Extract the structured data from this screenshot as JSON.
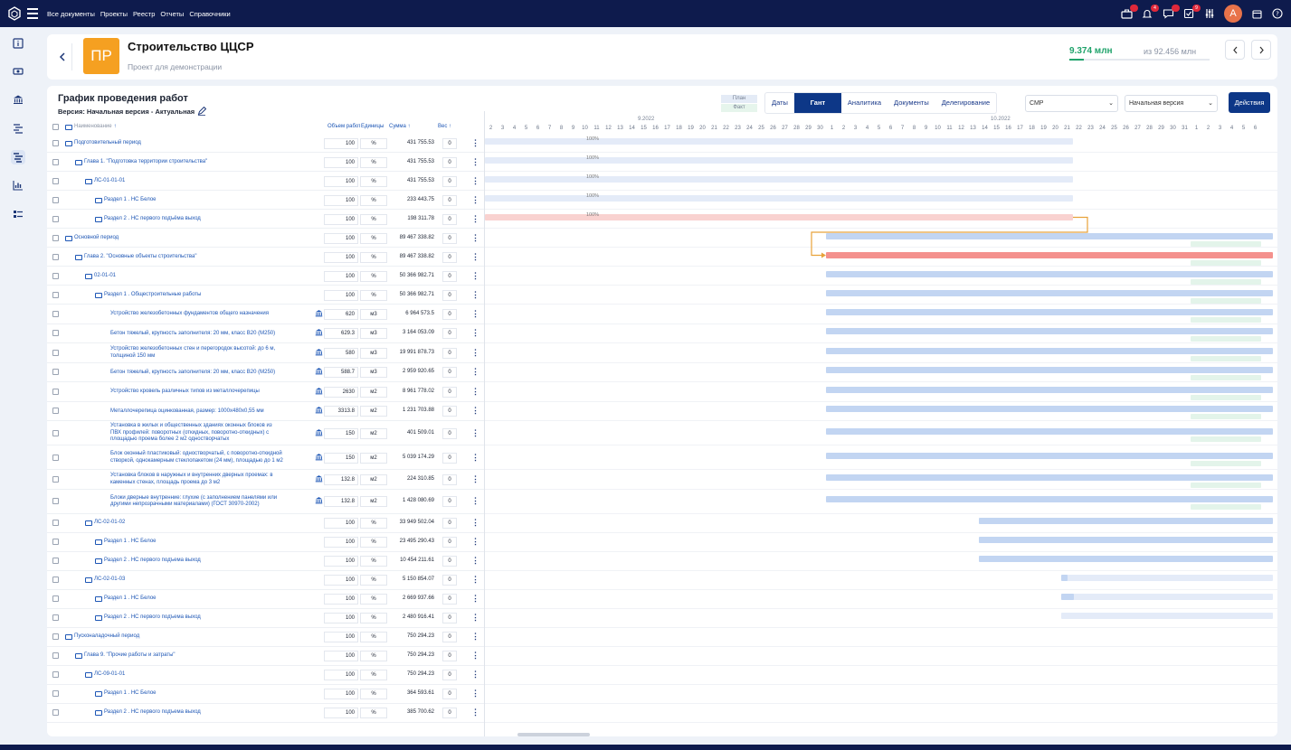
{
  "topbar": {
    "menu": [
      "Все документы",
      "Проекты",
      "Реестр",
      "Отчеты",
      "Справочники"
    ],
    "badges": [
      "",
      "4",
      "",
      "9"
    ],
    "avatar": "A"
  },
  "header": {
    "logo_text": "ПР",
    "title": "Строительство ЦЦСР",
    "subtitle": "Проект для демонстрации",
    "spent": "9.374 млн",
    "total": "из 92.456 млн",
    "progress": 0.101
  },
  "main": {
    "title": "График проведения работ",
    "version": "Версия: Начальная версия - Актуальная",
    "legend": {
      "plan": "План",
      "fact": "Факт"
    },
    "tabs": [
      "Даты",
      "Гант",
      "Аналитика",
      "Документы",
      "Делегирование"
    ],
    "active_tab": "Гант",
    "select1": "СМР",
    "select2": "Начальная версия",
    "actions": "Действия"
  },
  "columns": {
    "name": "Наименование",
    "volume": "Объем работ",
    "unit": "Единицы",
    "sum": "Сумма",
    "weight": "Вес"
  },
  "rows": [
    {
      "level": 0,
      "folder": true,
      "name": "Подготовительный период",
      "volume": "100",
      "unit": "%",
      "sum": "431 755.53",
      "weight": "0"
    },
    {
      "level": 1,
      "folder": true,
      "name": "Глава 1. \"Подготовка территории строительства\"",
      "volume": "100",
      "unit": "%",
      "sum": "431 755.53",
      "weight": "0"
    },
    {
      "level": 2,
      "folder": true,
      "name": "ЛС-01-01-01",
      "volume": "100",
      "unit": "%",
      "sum": "431 755.53",
      "weight": "0"
    },
    {
      "level": 3,
      "folder": true,
      "name": "Раздел 1 . НС Белое",
      "volume": "100",
      "unit": "%",
      "sum": "233 443.75",
      "weight": "0"
    },
    {
      "level": 3,
      "folder": true,
      "name": "Раздел 2 . НС первого подъёма выход",
      "volume": "100",
      "unit": "%",
      "sum": "198 311.78",
      "weight": "0"
    },
    {
      "level": 0,
      "folder": true,
      "name": "Основной период",
      "volume": "100",
      "unit": "%",
      "sum": "89 467 338.82",
      "weight": "0"
    },
    {
      "level": 1,
      "folder": true,
      "name": "Глава 2. \"Основные объекты строительства\"",
      "volume": "100",
      "unit": "%",
      "sum": "89 467 338.82",
      "weight": "0"
    },
    {
      "level": 2,
      "folder": true,
      "name": "02-01-01",
      "volume": "100",
      "unit": "%",
      "sum": "50 366 982.71",
      "weight": "0"
    },
    {
      "level": 3,
      "folder": true,
      "name": "Раздел 1 . Общестроительные работы",
      "volume": "100",
      "unit": "%",
      "sum": "50 366 982.71",
      "weight": "0"
    },
    {
      "level": 4,
      "folder": false,
      "name": "Устройство железобетонных фундаментов общего назначения",
      "volume": "620",
      "unit": "м3",
      "sum": "6 964 573.5",
      "weight": "0"
    },
    {
      "level": 4,
      "folder": false,
      "name": "Бетон тяжелый, крупность заполнителя: 20 мм, класс В20 (М250)",
      "volume": "629.3",
      "unit": "м3",
      "sum": "3 164 053.09",
      "weight": "0"
    },
    {
      "level": 4,
      "folder": false,
      "name": "Устройство железобетонных стен и перегородок высотой: до 6 м, толщиной 150 мм",
      "volume": "580",
      "unit": "м3",
      "sum": "19 991 878.73",
      "weight": "0"
    },
    {
      "level": 4,
      "folder": false,
      "name": "Бетон тяжелый, крупность заполнителя: 20 мм, класс В20 (М250)",
      "volume": "588.7",
      "unit": "м3",
      "sum": "2 959 920.65",
      "weight": "0"
    },
    {
      "level": 4,
      "folder": false,
      "name": "Устройство кровель различных типов из металлочерепицы",
      "volume": "2630",
      "unit": "м2",
      "sum": "8 961 778.02",
      "weight": "0"
    },
    {
      "level": 4,
      "folder": false,
      "name": "Металлочерепица оцинкованная, размер: 1000x480x0,55 мм",
      "volume": "3313.8",
      "unit": "м2",
      "sum": "1 231 703.88",
      "weight": "0"
    },
    {
      "level": 4,
      "folder": false,
      "name": "Установка в жилых и общественных зданиях оконных блоков из ПВХ профилей: поворотных (откидных, поворотно-откидных) с площадью проема более 2 м2 одностворчатых",
      "volume": "150",
      "unit": "м2",
      "sum": "401 509.01",
      "weight": "0"
    },
    {
      "level": 4,
      "folder": false,
      "name": "Блок оконный пластиковый: одностворчатый, с поворотно-откидной створкой, однокамерным стеклопакетом (24 мм), площадью до 1 м2",
      "volume": "150",
      "unit": "м2",
      "sum": "5 039 174.29",
      "weight": "0"
    },
    {
      "level": 4,
      "folder": false,
      "name": "Установка блоков в наружных и внутренних дверных проемах: в каменных стенах, площадь проема до 3 м2",
      "volume": "132.8",
      "unit": "м2",
      "sum": "224 310.85",
      "weight": "0"
    },
    {
      "level": 4,
      "folder": false,
      "name": "Блоки дверные внутренние: глухие (с заполнением панелями или другими непрозрачными материалами) (ГОСТ 30970-2002)",
      "volume": "132.8",
      "unit": "м2",
      "sum": "1 428 080.69",
      "weight": "0"
    },
    {
      "level": 2,
      "folder": true,
      "name": "ЛС-02-01-02",
      "volume": "100",
      "unit": "%",
      "sum": "33 949 502.04",
      "weight": "0"
    },
    {
      "level": 3,
      "folder": true,
      "name": "Раздел 1 . НС Белое",
      "volume": "100",
      "unit": "%",
      "sum": "23 495 290.43",
      "weight": "0"
    },
    {
      "level": 3,
      "folder": true,
      "name": "Раздел 2 . НС первого подъема выход",
      "volume": "100",
      "unit": "%",
      "sum": "10 454 211.61",
      "weight": "0"
    },
    {
      "level": 2,
      "folder": true,
      "name": "ЛС-02-01-03",
      "volume": "100",
      "unit": "%",
      "sum": "5 150 854.07",
      "weight": "0"
    },
    {
      "level": 3,
      "folder": true,
      "name": "Раздел 1 . НС Белое",
      "volume": "100",
      "unit": "%",
      "sum": "2 669 937.66",
      "weight": "0"
    },
    {
      "level": 3,
      "folder": true,
      "name": "Раздел 2 . НС первого подъема выход",
      "volume": "100",
      "unit": "%",
      "sum": "2 480 916.41",
      "weight": "0"
    },
    {
      "level": 0,
      "folder": true,
      "name": "Пусконаладочный период",
      "volume": "100",
      "unit": "%",
      "sum": "750 294.23",
      "weight": "0"
    },
    {
      "level": 1,
      "folder": true,
      "name": "Глава 9. \"Прочие работы и затраты\"",
      "volume": "100",
      "unit": "%",
      "sum": "750 294.23",
      "weight": "0"
    },
    {
      "level": 2,
      "folder": true,
      "name": "ЛС-09-01-01",
      "volume": "100",
      "unit": "%",
      "sum": "750 294.23",
      "weight": "0"
    },
    {
      "level": 3,
      "folder": true,
      "name": "Раздел 1 . НС Белое",
      "volume": "100",
      "unit": "%",
      "sum": "364 593.61",
      "weight": "0"
    },
    {
      "level": 3,
      "folder": true,
      "name": "Раздел 2 . НС первого подъема выход",
      "volume": "100",
      "unit": "%",
      "sum": "385 700.62",
      "weight": "0"
    }
  ],
  "gantt": {
    "months": [
      {
        "label": "9.2022",
        "day_index": 13
      },
      {
        "label": "10.2022",
        "day_index": 43
      }
    ],
    "days": [
      "2",
      "3",
      "4",
      "5",
      "6",
      "7",
      "8",
      "9",
      "10",
      "11",
      "12",
      "13",
      "14",
      "15",
      "16",
      "17",
      "18",
      "19",
      "20",
      "21",
      "22",
      "23",
      "24",
      "25",
      "26",
      "27",
      "28",
      "29",
      "30",
      "1",
      "2",
      "3",
      "4",
      "5",
      "6",
      "7",
      "8",
      "9",
      "10",
      "11",
      "12",
      "13",
      "14",
      "15",
      "16",
      "17",
      "18",
      "19",
      "20",
      "21",
      "22",
      "23",
      "24",
      "25",
      "26",
      "27",
      "28",
      "29",
      "30",
      "31",
      "1",
      "2",
      "3",
      "4",
      "5",
      "6"
    ],
    "plan_color": "#c9d8f2",
    "fact_color": "#e3f4ea",
    "critical_color": "#f4918d",
    "bars": [
      {
        "row": 0,
        "start": 0,
        "end": 50,
        "kind": "plan-light",
        "label": "100%"
      },
      {
        "row": 1,
        "start": 0,
        "end": 50,
        "kind": "plan-light",
        "label": "100%"
      },
      {
        "row": 2,
        "start": 0,
        "end": 50,
        "kind": "plan-light",
        "label": "100%"
      },
      {
        "row": 3,
        "start": 0,
        "end": 50,
        "kind": "plan-light",
        "label": "100%"
      },
      {
        "row": 4,
        "start": 0,
        "end": 50,
        "kind": "critical-light",
        "label": "100%"
      },
      {
        "row": 5,
        "start": 29,
        "end": 67,
        "kind": "plan"
      },
      {
        "row": 6,
        "start": 29,
        "end": 67,
        "kind": "critical"
      },
      {
        "row": 7,
        "start": 29,
        "end": 67,
        "kind": "plan"
      },
      {
        "row": 8,
        "start": 29,
        "end": 67,
        "kind": "plan"
      },
      {
        "row": 9,
        "start": 29,
        "end": 67,
        "kind": "plan"
      },
      {
        "row": 10,
        "start": 29,
        "end": 67,
        "kind": "plan"
      },
      {
        "row": 11,
        "start": 29,
        "end": 67,
        "kind": "plan"
      },
      {
        "row": 12,
        "start": 29,
        "end": 67,
        "kind": "plan"
      },
      {
        "row": 13,
        "start": 29,
        "end": 67,
        "kind": "plan"
      },
      {
        "row": 14,
        "start": 29,
        "end": 67,
        "kind": "plan"
      },
      {
        "row": 15,
        "start": 29,
        "end": 67,
        "kind": "plan"
      },
      {
        "row": 16,
        "start": 29,
        "end": 67,
        "kind": "plan"
      },
      {
        "row": 17,
        "start": 29,
        "end": 67,
        "kind": "plan"
      },
      {
        "row": 18,
        "start": 29,
        "end": 67,
        "kind": "plan"
      },
      {
        "row": 19,
        "start": 42,
        "end": 67,
        "kind": "plan"
      },
      {
        "row": 20,
        "start": 42,
        "end": 67,
        "kind": "plan"
      },
      {
        "row": 21,
        "start": 42,
        "end": 67,
        "kind": "plan"
      },
      {
        "row": 22,
        "start": 49,
        "end": 67,
        "kind": "plan-light"
      },
      {
        "row": 23,
        "start": 49,
        "end": 67,
        "kind": "plan-light"
      },
      {
        "row": 24,
        "start": 49,
        "end": 67,
        "kind": "plan-light"
      }
    ],
    "fact_from_row": 5,
    "fact_to_row": 18,
    "fact_start": 60
  }
}
